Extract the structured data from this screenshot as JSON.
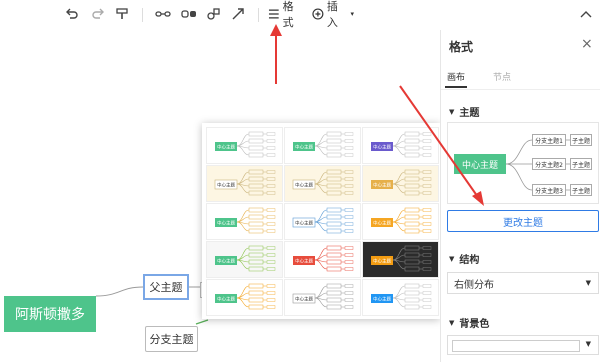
{
  "toolbar": {
    "format_label": "格式",
    "insert_label": "插入"
  },
  "canvas": {
    "root_label": "阿斯顿撒多",
    "parent_label": "父主题",
    "branch_label": "分支主题"
  },
  "popup": {
    "center_label": "中心主题"
  },
  "panel": {
    "title": "格式",
    "tabs": [
      "画布",
      "节点"
    ],
    "theme_heading": "主题",
    "preview": {
      "center": "中心主题",
      "branches": [
        "分支主题1",
        "分支主题2",
        "分支主题3"
      ],
      "subs": [
        "子主题",
        "子主题",
        "子主题"
      ]
    },
    "change_theme_label": "更改主题",
    "structure_heading": "结构",
    "structure_value": "右侧分布",
    "bg_heading": "背景色"
  },
  "colors": {
    "accent": "#2f7be5",
    "center_green": "#4ec48b",
    "annotation_red": "#e53935"
  }
}
